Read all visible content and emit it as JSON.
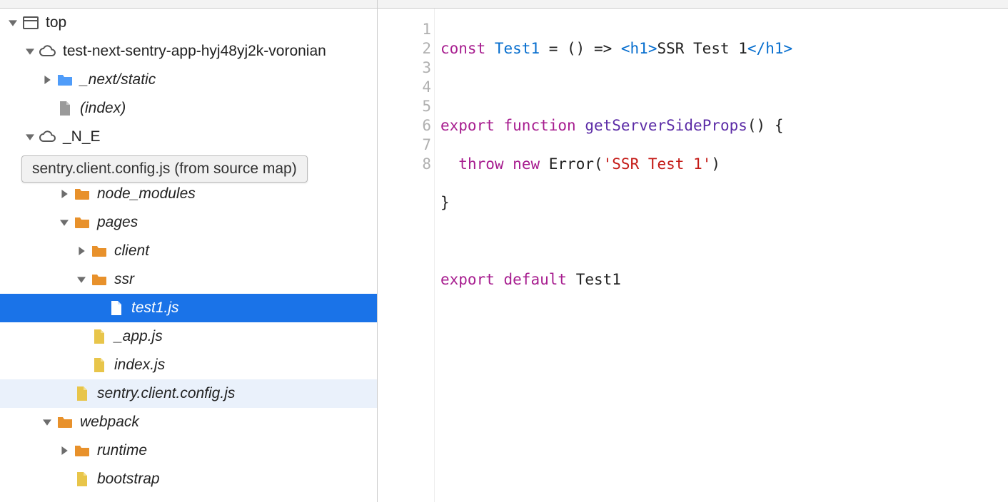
{
  "tooltip": "sentry.client.config.js (from source map)",
  "tree": {
    "top": "top",
    "domain": "test-next-sentry-app-hyj48yj2k-voronian",
    "next_static": "_next/static",
    "index": "(index)",
    "n_e": "_N_E",
    "node_modules": "node_modules",
    "pages": "pages",
    "client": "client",
    "ssr": "ssr",
    "test1": "test1.js",
    "app_js": "_app.js",
    "index_js": "index.js",
    "sentry_cfg": "sentry.client.config.js",
    "webpack": "webpack",
    "runtime": "runtime",
    "bootstrap": "bootstrap"
  },
  "gutter": [
    "1",
    "2",
    "3",
    "4",
    "5",
    "6",
    "7",
    "8"
  ],
  "code": {
    "l1": {
      "const": "const",
      "Test1": "Test1",
      "eq": " = () => ",
      "h1o": "<h1>",
      "txt": "SSR Test 1",
      "h1c": "</h1>"
    },
    "l3": {
      "export": "export",
      "function": "function",
      "fn": "getServerSideProps",
      "tail": "() {"
    },
    "l4": {
      "throw": "throw",
      "new": "new",
      "Error": "Error",
      "po": "(",
      "str": "'SSR Test 1'",
      "pc": ")"
    },
    "l5": "}",
    "l7": {
      "export": "export",
      "default": "default",
      "Test1": "Test1"
    }
  }
}
